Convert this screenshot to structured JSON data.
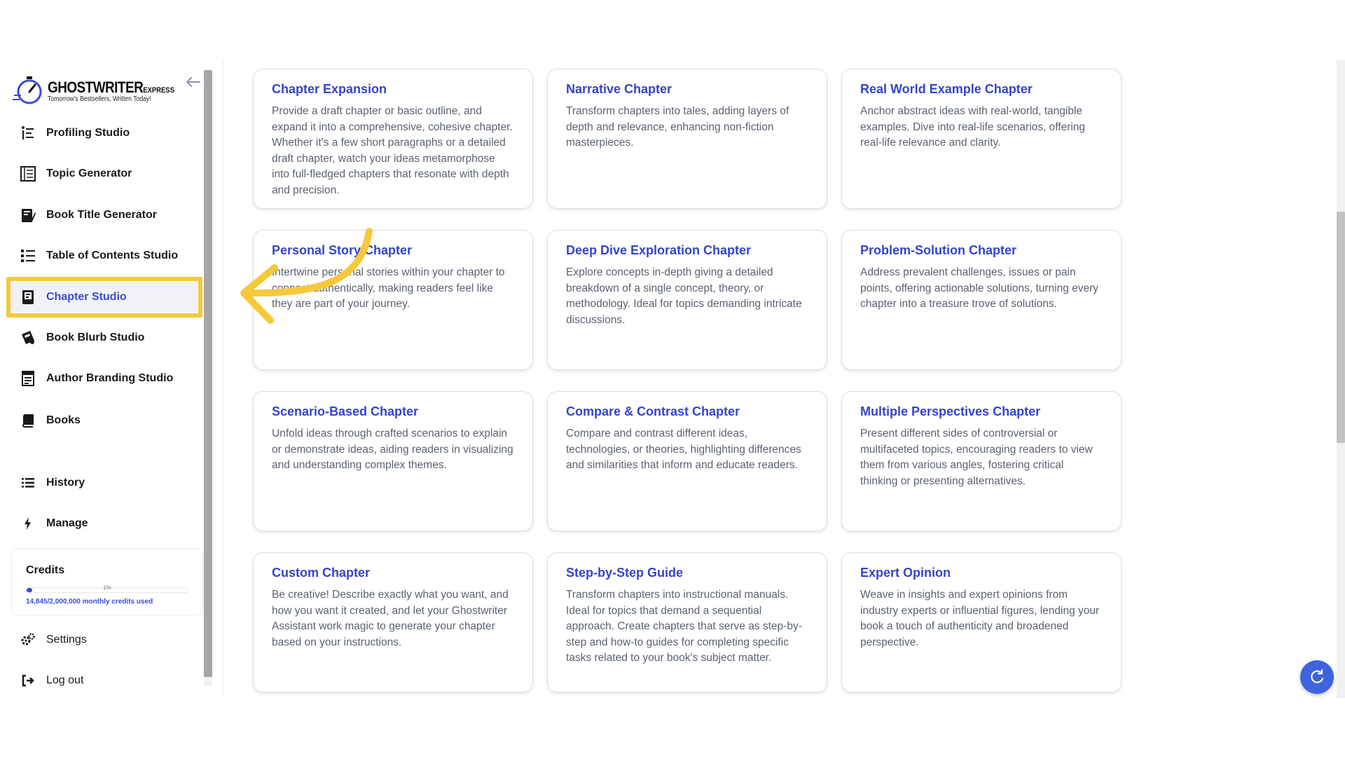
{
  "logo": {
    "title_main": "GHOSTWRITER",
    "title_suffix": "EXPRESS",
    "tagline": "Tomorrow's Bestsellers, Written Today!"
  },
  "sidebar": {
    "items": [
      {
        "label": "Profiling Studio",
        "icon": "profiling-icon"
      },
      {
        "label": "Topic Generator",
        "icon": "topic-list-icon"
      },
      {
        "label": "Book Title Generator",
        "icon": "book-title-icon"
      },
      {
        "label": "Table of Contents Studio",
        "icon": "toc-icon"
      },
      {
        "label": "Chapter Studio",
        "icon": "chapter-icon",
        "active": true
      },
      {
        "label": "Book Blurb Studio",
        "icon": "blurb-icon"
      },
      {
        "label": "Author Branding Studio",
        "icon": "branding-icon"
      },
      {
        "label": "Books",
        "icon": "book-icon"
      },
      {
        "label": "History",
        "icon": "history-icon"
      },
      {
        "label": "Manage",
        "icon": "bolt-icon"
      }
    ],
    "credits": {
      "label": "Credits",
      "percent_text": "1%",
      "used_fraction": 0.0074,
      "used_text": "14,845/2,000,000 monthly credits used"
    },
    "footer": [
      {
        "label": "Settings",
        "icon": "gears-icon"
      },
      {
        "label": "Log out",
        "icon": "logout-icon"
      }
    ]
  },
  "cards": [
    {
      "title": "Chapter Expansion",
      "desc": "Provide a draft chapter or basic outline, and expand it into a comprehensive, cohesive chapter. Whether it's a few short paragraphs or a detailed draft chapter, watch your ideas metamorphose into full-fledged chapters that resonate with depth and precision."
    },
    {
      "title": "Narrative Chapter",
      "desc": "Transform chapters into tales, adding layers of depth and relevance, enhancing non-fiction masterpieces."
    },
    {
      "title": "Real World Example Chapter",
      "desc": "Anchor abstract ideas with real-world, tangible examples. Dive into real-life scenarios, offering real-life relevance and clarity."
    },
    {
      "title": "Personal Story Chapter",
      "desc": "Intertwine personal stories within your chapter to connect authentically, making readers feel like they are part of your journey."
    },
    {
      "title": "Deep Dive Exploration Chapter",
      "desc": "Explore concepts in-depth giving a detailed breakdown of a single concept, theory, or methodology. Ideal for topics demanding intricate discussions."
    },
    {
      "title": "Problem-Solution Chapter",
      "desc": "Address prevalent challenges, issues or pain points, offering actionable solutions, turning every chapter into a treasure trove of solutions."
    },
    {
      "title": "Scenario-Based Chapter",
      "desc": "Unfold ideas through crafted scenarios to explain or demonstrate ideas, aiding readers in visualizing and understanding complex themes."
    },
    {
      "title": "Compare & Contrast Chapter",
      "desc": "Compare and contrast different ideas, technologies, or theories, highlighting differences and similarities that inform and educate readers."
    },
    {
      "title": "Multiple Perspectives Chapter",
      "desc": "Present different sides of controversial or multifaceted topics, encouraging readers to view them from various angles, fostering critical thinking or presenting alternatives."
    },
    {
      "title": "Custom Chapter",
      "desc": "Be creative! Describe exactly what you want, and how you want it created, and let your Ghostwriter Assistant work magic to generate your chapter based on your instructions."
    },
    {
      "title": "Step-by-Step Guide",
      "desc": "Transform chapters into instructional manuals. Ideal for topics that demand a sequential approach. Create chapters that serve as step-by-step and how-to guides for completing specific tasks related to your book's subject matter."
    },
    {
      "title": "Expert Opinion",
      "desc": "Weave in insights and expert opinions from industry experts or influential figures, lending your book a touch of authenticity and broadened perspective."
    }
  ],
  "colors": {
    "accent": "#3b4bd8",
    "card_title": "#3445c8",
    "highlight": "#f6c93c",
    "chat_button": "#3e63dd"
  }
}
